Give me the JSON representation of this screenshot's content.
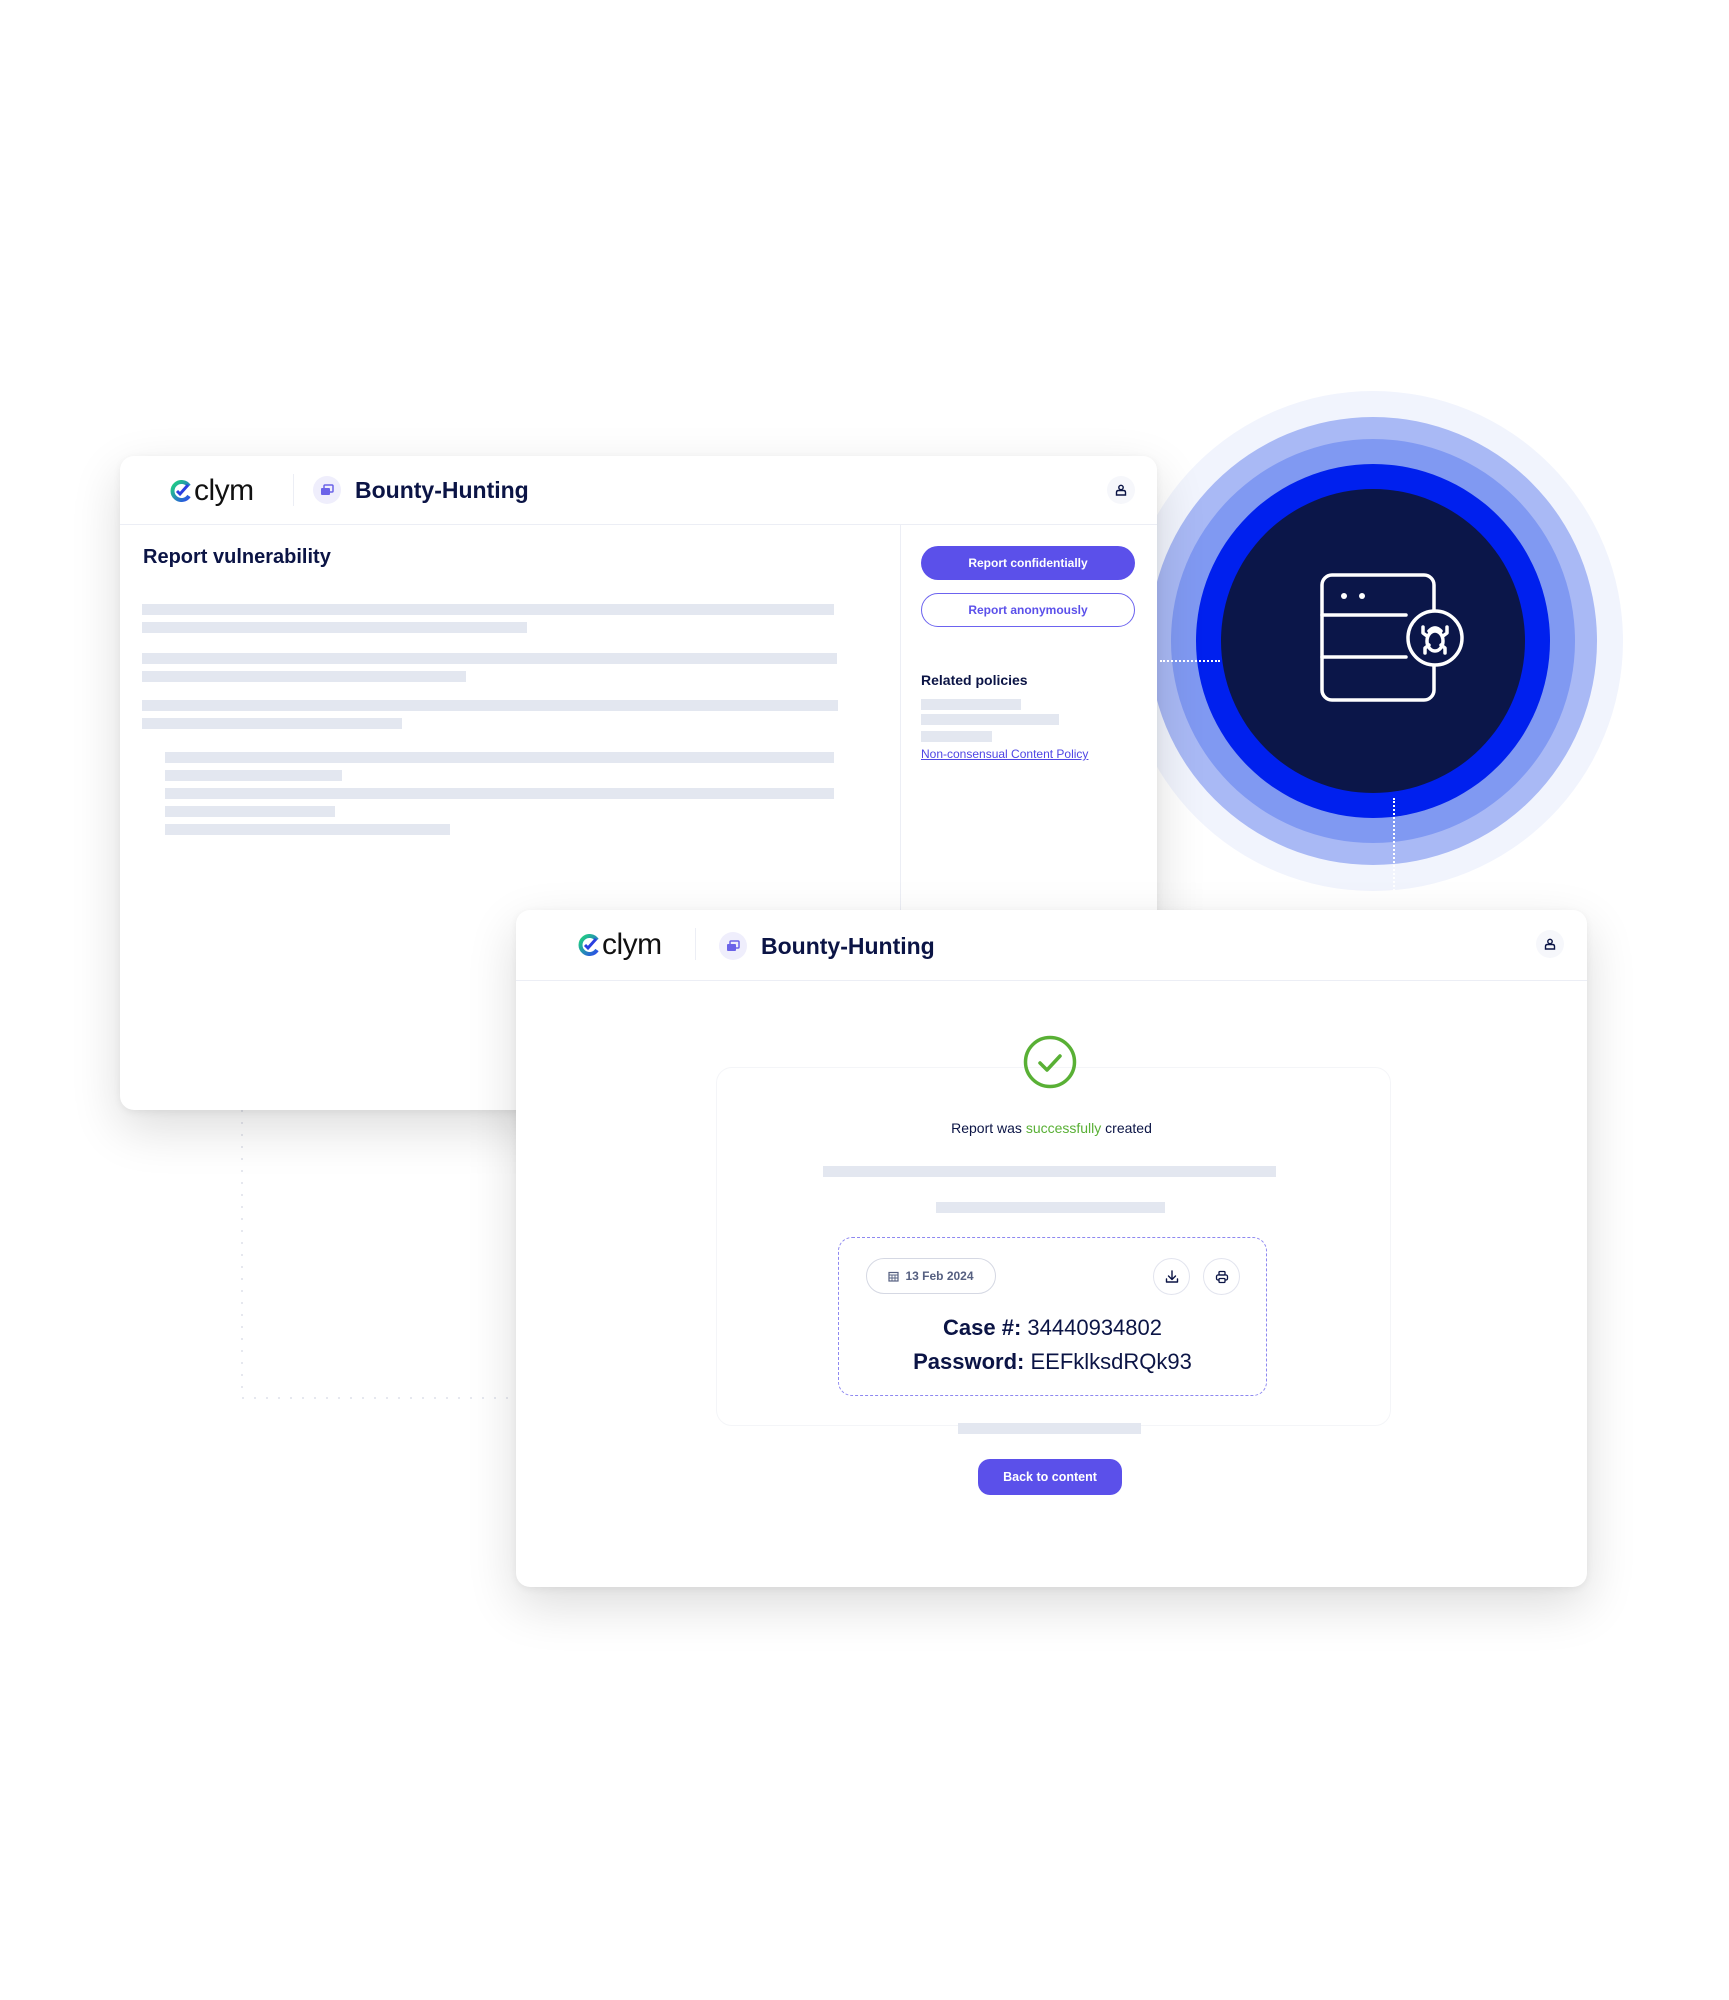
{
  "brand": {
    "logo_text": "clym",
    "app_name": "Bounty-Hunting"
  },
  "colors": {
    "primary": "#5b50ea",
    "navy": "#0b1445",
    "success": "#59b035",
    "ring_blue": "#0020ee",
    "ring_navy": "#0b1649"
  },
  "report_page": {
    "title": "Report vulnerability",
    "report_confidentially_label": "Report confidentially",
    "report_anonymously_label": "Report anonymously",
    "related_policies_heading": "Related policies",
    "policy_link": "Non-consensual Content Policy"
  },
  "hero_icon": {
    "name": "server-bug-icon"
  },
  "confirmation_page": {
    "message_prefix": "Report was ",
    "message_highlight": "successfully",
    "message_suffix": " created",
    "date": "13 Feb 2024",
    "case_label": "Case #:",
    "case_number": "34440934802",
    "password_label": "Password:",
    "password_value": "EEFklksdRQk93",
    "download_icon": "download-icon",
    "print_icon": "print-icon",
    "back_button_label": "Back to content"
  }
}
